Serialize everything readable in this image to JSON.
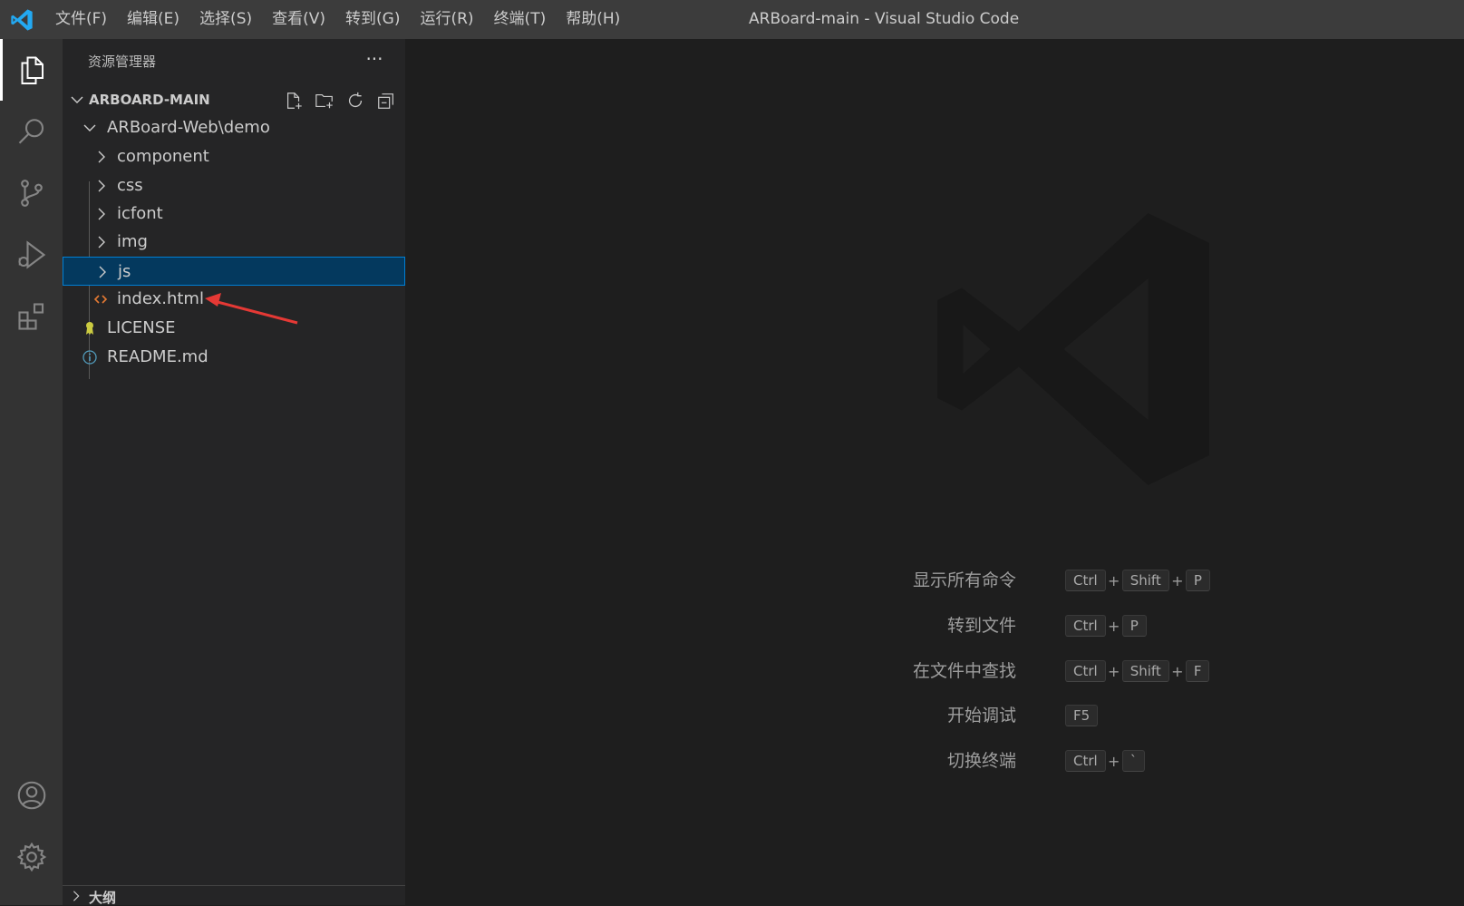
{
  "menu": [
    "文件(F)",
    "编辑(E)",
    "选择(S)",
    "查看(V)",
    "转到(G)",
    "运行(R)",
    "终端(T)",
    "帮助(H)"
  ],
  "window_title": "ARBoard-main - Visual Studio Code",
  "sidebar": {
    "title": "资源管理器",
    "more": "···",
    "section_title": "ARBOARD-MAIN",
    "tree": [
      {
        "label": "ARBoard-Web\\demo",
        "kind": "folder-open"
      },
      {
        "label": "component",
        "kind": "folder"
      },
      {
        "label": "css",
        "kind": "folder"
      },
      {
        "label": "icfont",
        "kind": "folder"
      },
      {
        "label": "img",
        "kind": "folder"
      },
      {
        "label": "js",
        "kind": "folder",
        "selected": true
      },
      {
        "label": "index.html",
        "kind": "html-file"
      },
      {
        "label": "LICENSE",
        "kind": "license-file"
      },
      {
        "label": "README.md",
        "kind": "info-file"
      }
    ],
    "outline_title": "大纲"
  },
  "shortcuts": [
    {
      "label": "显示所有命令",
      "keys": [
        "Ctrl",
        "Shift",
        "P"
      ]
    },
    {
      "label": "转到文件",
      "keys": [
        "Ctrl",
        "P"
      ]
    },
    {
      "label": "在文件中查找",
      "keys": [
        "Ctrl",
        "Shift",
        "F"
      ]
    },
    {
      "label": "开始调试",
      "keys": [
        "F5"
      ]
    },
    {
      "label": "切换终端",
      "keys": [
        "Ctrl",
        "`"
      ]
    }
  ],
  "colors": {
    "accent": "#007acc",
    "selection": "#04395e",
    "html_icon": "#e37933",
    "license_icon": "#cbcb41",
    "info_icon": "#519aba",
    "annotation_arrow": "#e53935"
  },
  "icons": {
    "activity": [
      "explorer-icon",
      "search-icon",
      "source-control-icon",
      "run-debug-icon",
      "extensions-icon",
      "account-icon",
      "settings-gear-icon"
    ],
    "section_actions": [
      "new-file-icon",
      "new-folder-icon",
      "refresh-icon",
      "collapse-all-icon"
    ]
  }
}
